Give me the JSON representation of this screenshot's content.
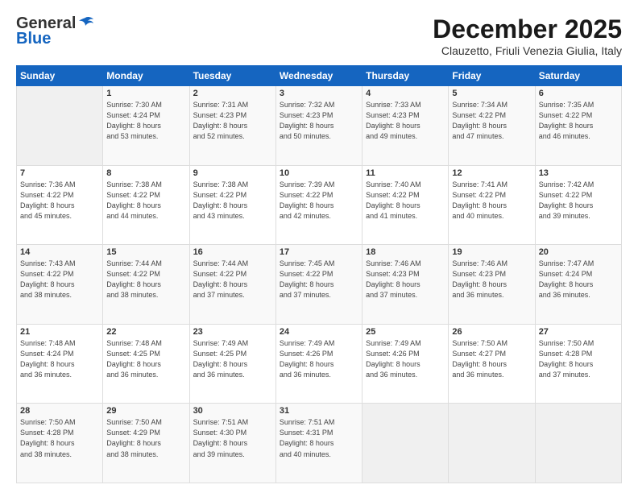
{
  "logo": {
    "general": "General",
    "blue": "Blue"
  },
  "title": "December 2025",
  "subtitle": "Clauzetto, Friuli Venezia Giulia, Italy",
  "days_header": [
    "Sunday",
    "Monday",
    "Tuesday",
    "Wednesday",
    "Thursday",
    "Friday",
    "Saturday"
  ],
  "weeks": [
    [
      {
        "num": "",
        "info": ""
      },
      {
        "num": "1",
        "info": "Sunrise: 7:30 AM\nSunset: 4:24 PM\nDaylight: 8 hours\nand 53 minutes."
      },
      {
        "num": "2",
        "info": "Sunrise: 7:31 AM\nSunset: 4:23 PM\nDaylight: 8 hours\nand 52 minutes."
      },
      {
        "num": "3",
        "info": "Sunrise: 7:32 AM\nSunset: 4:23 PM\nDaylight: 8 hours\nand 50 minutes."
      },
      {
        "num": "4",
        "info": "Sunrise: 7:33 AM\nSunset: 4:23 PM\nDaylight: 8 hours\nand 49 minutes."
      },
      {
        "num": "5",
        "info": "Sunrise: 7:34 AM\nSunset: 4:22 PM\nDaylight: 8 hours\nand 47 minutes."
      },
      {
        "num": "6",
        "info": "Sunrise: 7:35 AM\nSunset: 4:22 PM\nDaylight: 8 hours\nand 46 minutes."
      }
    ],
    [
      {
        "num": "7",
        "info": "Sunrise: 7:36 AM\nSunset: 4:22 PM\nDaylight: 8 hours\nand 45 minutes."
      },
      {
        "num": "8",
        "info": "Sunrise: 7:38 AM\nSunset: 4:22 PM\nDaylight: 8 hours\nand 44 minutes."
      },
      {
        "num": "9",
        "info": "Sunrise: 7:38 AM\nSunset: 4:22 PM\nDaylight: 8 hours\nand 43 minutes."
      },
      {
        "num": "10",
        "info": "Sunrise: 7:39 AM\nSunset: 4:22 PM\nDaylight: 8 hours\nand 42 minutes."
      },
      {
        "num": "11",
        "info": "Sunrise: 7:40 AM\nSunset: 4:22 PM\nDaylight: 8 hours\nand 41 minutes."
      },
      {
        "num": "12",
        "info": "Sunrise: 7:41 AM\nSunset: 4:22 PM\nDaylight: 8 hours\nand 40 minutes."
      },
      {
        "num": "13",
        "info": "Sunrise: 7:42 AM\nSunset: 4:22 PM\nDaylight: 8 hours\nand 39 minutes."
      }
    ],
    [
      {
        "num": "14",
        "info": "Sunrise: 7:43 AM\nSunset: 4:22 PM\nDaylight: 8 hours\nand 38 minutes."
      },
      {
        "num": "15",
        "info": "Sunrise: 7:44 AM\nSunset: 4:22 PM\nDaylight: 8 hours\nand 38 minutes."
      },
      {
        "num": "16",
        "info": "Sunrise: 7:44 AM\nSunset: 4:22 PM\nDaylight: 8 hours\nand 37 minutes."
      },
      {
        "num": "17",
        "info": "Sunrise: 7:45 AM\nSunset: 4:22 PM\nDaylight: 8 hours\nand 37 minutes."
      },
      {
        "num": "18",
        "info": "Sunrise: 7:46 AM\nSunset: 4:23 PM\nDaylight: 8 hours\nand 37 minutes."
      },
      {
        "num": "19",
        "info": "Sunrise: 7:46 AM\nSunset: 4:23 PM\nDaylight: 8 hours\nand 36 minutes."
      },
      {
        "num": "20",
        "info": "Sunrise: 7:47 AM\nSunset: 4:24 PM\nDaylight: 8 hours\nand 36 minutes."
      }
    ],
    [
      {
        "num": "21",
        "info": "Sunrise: 7:48 AM\nSunset: 4:24 PM\nDaylight: 8 hours\nand 36 minutes."
      },
      {
        "num": "22",
        "info": "Sunrise: 7:48 AM\nSunset: 4:25 PM\nDaylight: 8 hours\nand 36 minutes."
      },
      {
        "num": "23",
        "info": "Sunrise: 7:49 AM\nSunset: 4:25 PM\nDaylight: 8 hours\nand 36 minutes."
      },
      {
        "num": "24",
        "info": "Sunrise: 7:49 AM\nSunset: 4:26 PM\nDaylight: 8 hours\nand 36 minutes."
      },
      {
        "num": "25",
        "info": "Sunrise: 7:49 AM\nSunset: 4:26 PM\nDaylight: 8 hours\nand 36 minutes."
      },
      {
        "num": "26",
        "info": "Sunrise: 7:50 AM\nSunset: 4:27 PM\nDaylight: 8 hours\nand 36 minutes."
      },
      {
        "num": "27",
        "info": "Sunrise: 7:50 AM\nSunset: 4:28 PM\nDaylight: 8 hours\nand 37 minutes."
      }
    ],
    [
      {
        "num": "28",
        "info": "Sunrise: 7:50 AM\nSunset: 4:28 PM\nDaylight: 8 hours\nand 38 minutes."
      },
      {
        "num": "29",
        "info": "Sunrise: 7:50 AM\nSunset: 4:29 PM\nDaylight: 8 hours\nand 38 minutes."
      },
      {
        "num": "30",
        "info": "Sunrise: 7:51 AM\nSunset: 4:30 PM\nDaylight: 8 hours\nand 39 minutes."
      },
      {
        "num": "31",
        "info": "Sunrise: 7:51 AM\nSunset: 4:31 PM\nDaylight: 8 hours\nand 40 minutes."
      },
      {
        "num": "",
        "info": ""
      },
      {
        "num": "",
        "info": ""
      },
      {
        "num": "",
        "info": ""
      }
    ]
  ]
}
